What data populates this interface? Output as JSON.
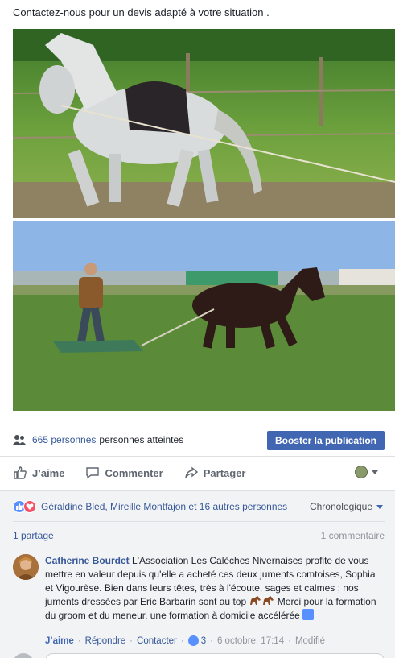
{
  "post": {
    "text": "Contactez-nous pour un devis adapté à votre situation ."
  },
  "photos": [
    {
      "icon": "photo-grey-horse-lunging"
    },
    {
      "icon": "photo-horse-pulling-sledge"
    }
  ],
  "reach": {
    "count": "665 personnes",
    "label": "personnes atteintes",
    "boost_label": "Booster la publication"
  },
  "actions": {
    "like": "J’aime",
    "comment": "Commenter",
    "share": "Partager"
  },
  "reactions": {
    "summary": "Géraldine Bled, Mireille Montfajon et 16 autres personnes",
    "sort": "Chronologique"
  },
  "stats": {
    "shares": "1 partage",
    "comments": "1 commentaire"
  },
  "comment": {
    "author": "Catherine Bourdet",
    "text_part1": " L'Association Les Calèches Nivernaises profite de vous mettre en valeur depuis qu'elle a acheté ces deux juments comtoises, Sophia et Vigourèse. Bien dans leurs têtes, très à l'écoute, sages et calmes ; nos juments dressées par Eric Barbarin sont au top ",
    "text_part2": " Merci pour la formation du groom et du meneur, une formation à domicile accélérée ",
    "like_label": "J’aime",
    "reply_label": "Répondre",
    "contact_label": "Contacter",
    "like_count": "3",
    "timestamp": "6 octobre, 17:14",
    "edited": "Modifié"
  },
  "colors": {
    "link": "#365899",
    "boost": "#4267b2",
    "gray_bg": "#f2f3f5"
  }
}
